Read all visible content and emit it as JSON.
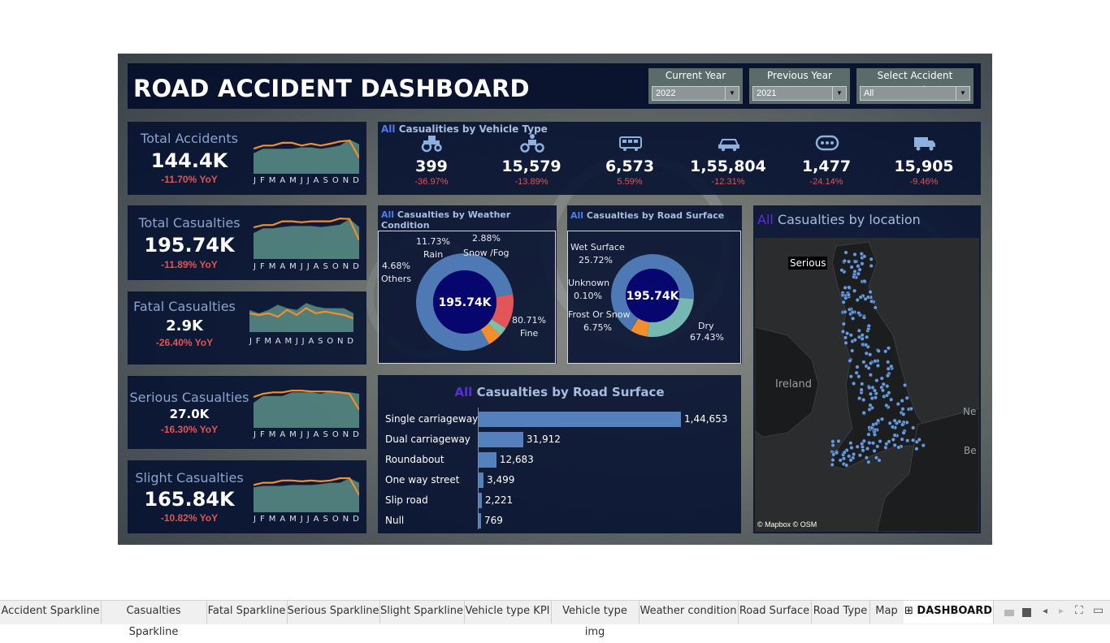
{
  "title": "ROAD ACCIDENT DASHBOARD",
  "filters": [
    {
      "label": "Current Year",
      "value": "2022"
    },
    {
      "label": "Previous Year",
      "value": "2021"
    },
    {
      "label": "Select Accident Severity",
      "value": "All"
    }
  ],
  "kpis": [
    {
      "title": "Total Accidents",
      "value": "144.4K",
      "yoy": "-11.70% YoY",
      "months": [
        "J",
        "F",
        "M",
        "A",
        "M",
        "J",
        "J",
        "A",
        "S",
        "O",
        "N",
        "D"
      ]
    },
    {
      "title": "Total Casualties",
      "value": "195.74K",
      "yoy": "-11.89% YoY",
      "months": [
        "J",
        "F",
        "M",
        "A",
        "M",
        "J",
        "J",
        "A",
        "S",
        "O",
        "N",
        "D"
      ]
    },
    {
      "title": "Fatal Casualties",
      "value": "2.9K",
      "yoy": "-26.40% YoY",
      "months": [
        "J",
        "F",
        "M",
        "A",
        "M",
        "J",
        "J",
        "A",
        "S",
        "O",
        "N",
        "D"
      ]
    },
    {
      "title": "Serious Casualties",
      "value": "27.0K",
      "yoy": "-16.30% YoY",
      "months": [
        "J",
        "F",
        "M",
        "A",
        "M",
        "J",
        "J",
        "A",
        "S",
        "O",
        "N",
        "D"
      ]
    },
    {
      "title": "Slight Casualties",
      "value": "165.84K",
      "yoy": "-10.82% YoY",
      "months": [
        "J",
        "F",
        "M",
        "A",
        "M",
        "J",
        "J",
        "A",
        "S",
        "O",
        "N",
        "D"
      ]
    }
  ],
  "vehicle": {
    "prefix": "All",
    "title": "Casualities by Vehicle Type",
    "items": [
      {
        "icon": "tractor-icon",
        "value": "399",
        "pct": "-36.97%"
      },
      {
        "icon": "motorcycle-icon",
        "value": "15,579",
        "pct": "-13.89%"
      },
      {
        "icon": "bus-icon",
        "value": "6,573",
        "pct": "5.59%"
      },
      {
        "icon": "car-icon",
        "value": "1,55,804",
        "pct": "-12.31%"
      },
      {
        "icon": "other-vehicle-icon",
        "value": "1,477",
        "pct": "-24.14%"
      },
      {
        "icon": "truck-icon",
        "value": "15,905",
        "pct": "-9.46%"
      }
    ]
  },
  "weather": {
    "prefix": "All",
    "title": "Casualties by Weather Condition",
    "center": "195.74K",
    "labels": {
      "rain_pct": "11.73%",
      "rain": "Rain",
      "snow_pct": "2.88%",
      "snow": "Snow /Fog",
      "others_pct": "4.68%",
      "others": "Others",
      "fine_pct": "80.71%",
      "fine": "Fine"
    }
  },
  "surface_donut": {
    "prefix": "All",
    "title": "Casualties by Road Surface",
    "center": "195.74K",
    "labels": {
      "wet": "Wet Surface",
      "wet_pct": "25.72%",
      "unknown": "Unknown",
      "unknown_pct": "0.10%",
      "frost": "Frost Or Snow",
      "frost_pct": "6.75%",
      "dry": "Dry",
      "dry_pct": "67.43%"
    }
  },
  "location": {
    "prefix": "All",
    "title": "Casualties by location",
    "tooltip": "Serious",
    "ireland": "Ireland",
    "edge1": "Ne",
    "edge2": "Be",
    "credit": "© Mapbox © OSM"
  },
  "road_type": {
    "prefix": "All",
    "title": "Casualties by Road Surface"
  },
  "chart_data": [
    {
      "type": "pie",
      "title": "Casualties by Weather Condition",
      "categories": [
        "Fine",
        "Rain",
        "Snow /Fog",
        "Others"
      ],
      "values": [
        80.71,
        11.73,
        2.88,
        4.68
      ],
      "colors": [
        "#4e79b4",
        "#e15759",
        "#7fbfa6",
        "#f28e2b"
      ]
    },
    {
      "type": "pie",
      "title": "Casualties by Road Surface",
      "categories": [
        "Dry",
        "Wet Surface",
        "Frost Or Snow",
        "Unknown"
      ],
      "values": [
        67.43,
        25.72,
        6.75,
        0.1
      ],
      "colors": [
        "#4e79b4",
        "#76b7b2",
        "#f28e2b",
        "#e15759"
      ]
    },
    {
      "type": "bar",
      "title": "Casualties by Road Surface",
      "categories": [
        "Single carriageway",
        "Dual carriageway",
        "Roundabout",
        "One way street",
        "Slip road",
        "Null"
      ],
      "values": [
        144653,
        31912,
        12683,
        3499,
        2221,
        769
      ],
      "labels": [
        "1,44,653",
        "31,912",
        "12,683",
        "3,499",
        "2,221",
        "769"
      ]
    }
  ],
  "tabs": [
    "Accident Sparkline",
    "Casualties Sparkline",
    "Fatal Sparkline",
    "Serious Sparkline",
    "Slight Sparkline",
    "Vehicle type KPI",
    "Vehicle type img",
    "Weather condition",
    "Road Surface",
    "Road Type",
    "Map",
    "DASHBOARD"
  ]
}
